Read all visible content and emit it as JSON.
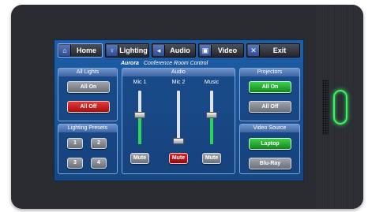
{
  "nav": {
    "home": {
      "label": "Home",
      "icon": "home-icon"
    },
    "lighting": {
      "label": "Lighting",
      "icon": "lightbulb-icon"
    },
    "audio": {
      "label": "Audio",
      "icon": "speaker-icon"
    },
    "video": {
      "label": "Video",
      "icon": "monitor-icon"
    },
    "exit": {
      "label": "Exit",
      "icon": "close-icon"
    }
  },
  "brand": {
    "logo": "Aurora",
    "title": "Conference Room Control"
  },
  "all_lights": {
    "title": "All Lights",
    "on": "All On",
    "off": "All Off"
  },
  "lighting_presets": {
    "title": "Lighting Presets",
    "presets": [
      "1",
      "2",
      "3",
      "4"
    ]
  },
  "audio": {
    "title": "Audio",
    "channels": [
      {
        "label": "Mic 1",
        "level": 0.55,
        "mute": "Mute",
        "muted": false
      },
      {
        "label": "Mic 2",
        "level": 0.0,
        "mute": "Mute",
        "muted": true
      },
      {
        "label": "Music",
        "level": 0.55,
        "mute": "Mute",
        "muted": false
      }
    ]
  },
  "projectors": {
    "title": "Projectors",
    "on": "All On",
    "off": "All Off"
  },
  "video_source": {
    "title": "Video Source",
    "sources": [
      "Laptop",
      "Blu-Ray"
    ],
    "selected": "Laptop"
  },
  "colors": {
    "accent_green": "#2fd454",
    "accent_red": "#c4161c",
    "screen_blue": "#1a5397",
    "power_led": "#3cf26a"
  }
}
